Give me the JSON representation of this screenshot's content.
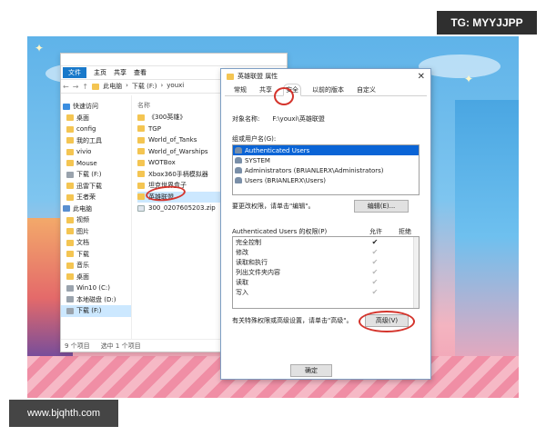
{
  "watermarks": {
    "top_right": "TG: MYYJJPP",
    "bottom_left": "www.bjqhth.com"
  },
  "explorer": {
    "ribbon_tabs": [
      "文件",
      "主页",
      "共享",
      "查看"
    ],
    "address": [
      "此电脑",
      "下载 (F:)",
      "youxi"
    ],
    "column_header": "名称",
    "nav_items": [
      {
        "label": "快速访问",
        "icon": "star-icon"
      },
      {
        "label": "桌面",
        "icon": "folder-icon"
      },
      {
        "label": "config",
        "icon": "folder-icon"
      },
      {
        "label": "我的工具",
        "icon": "folder-icon"
      },
      {
        "label": "vivio",
        "icon": "folder-icon"
      },
      {
        "label": "Mouse",
        "icon": "folder-icon"
      },
      {
        "label": "下载 (F:)",
        "icon": "drive-icon"
      },
      {
        "label": "迅雷下载",
        "icon": "folder-icon"
      },
      {
        "label": "王者荣",
        "icon": "folder-icon"
      },
      {
        "label": "此电脑",
        "icon": "pc-icon"
      },
      {
        "label": "视频",
        "icon": "folder-icon"
      },
      {
        "label": "图片",
        "icon": "folder-icon"
      },
      {
        "label": "文档",
        "icon": "folder-icon"
      },
      {
        "label": "下载",
        "icon": "folder-icon"
      },
      {
        "label": "音乐",
        "icon": "folder-icon"
      },
      {
        "label": "桌面",
        "icon": "folder-icon"
      },
      {
        "label": "Win10 (C:)",
        "icon": "drive-icon"
      },
      {
        "label": "本地磁盘 (D:)",
        "icon": "drive-icon"
      },
      {
        "label": "下载 (F:)",
        "icon": "drive-icon"
      }
    ],
    "files": [
      {
        "label": "《300英雄》",
        "icon": "folder-icon"
      },
      {
        "label": "TGP",
        "icon": "folder-icon"
      },
      {
        "label": "World_of_Tanks",
        "icon": "folder-icon"
      },
      {
        "label": "World_of_Warships",
        "icon": "folder-icon"
      },
      {
        "label": "WOTBox",
        "icon": "folder-icon"
      },
      {
        "label": "Xbox360手柄模拟器",
        "icon": "folder-icon"
      },
      {
        "label": "坦克世界盒子",
        "icon": "folder-icon"
      },
      {
        "label": "英雄联盟",
        "icon": "folder-icon"
      },
      {
        "label": "300_0207605203.zip",
        "icon": "file-icon"
      }
    ],
    "status": [
      "9 个项目",
      "选中 1 个项目"
    ]
  },
  "dialog": {
    "title": "英雄联盟 属性",
    "tabs": [
      "常规",
      "共享",
      "安全",
      "以前的版本",
      "自定义"
    ],
    "object_name_label": "对象名称:",
    "object_name_value": "F:\\youxi\\英雄联盟",
    "group_label": "组或用户名(G):",
    "users": [
      "Authenticated Users",
      "SYSTEM",
      "Administrators (BRIANLERX\\Administrators)",
      "Users (BRIANLERX\\Users)"
    ],
    "edit_hint": "要更改权限，请单击\"编辑\"。",
    "edit_button": "编辑(E)...",
    "perm_header": "Authenticated Users 的权限(P)",
    "allow_header": "允许",
    "deny_header": "拒绝",
    "permissions": [
      {
        "name": "完全控制",
        "allow": "✔",
        "allow_faint": false
      },
      {
        "name": "修改",
        "allow": "✔",
        "allow_faint": true
      },
      {
        "name": "读取和执行",
        "allow": "✔",
        "allow_faint": true
      },
      {
        "name": "列出文件夹内容",
        "allow": "✔",
        "allow_faint": true
      },
      {
        "name": "读取",
        "allow": "✔",
        "allow_faint": true
      },
      {
        "name": "写入",
        "allow": "✔",
        "allow_faint": true
      }
    ],
    "advanced_hint": "有关特殊权限或高级设置，请单击\"高级\"。",
    "advanced_button": "高级(V)",
    "ok_button": "确定"
  },
  "colors": {
    "accent": "#1979ca",
    "selection": "#0a64d6",
    "annotation": "#d4342c"
  }
}
